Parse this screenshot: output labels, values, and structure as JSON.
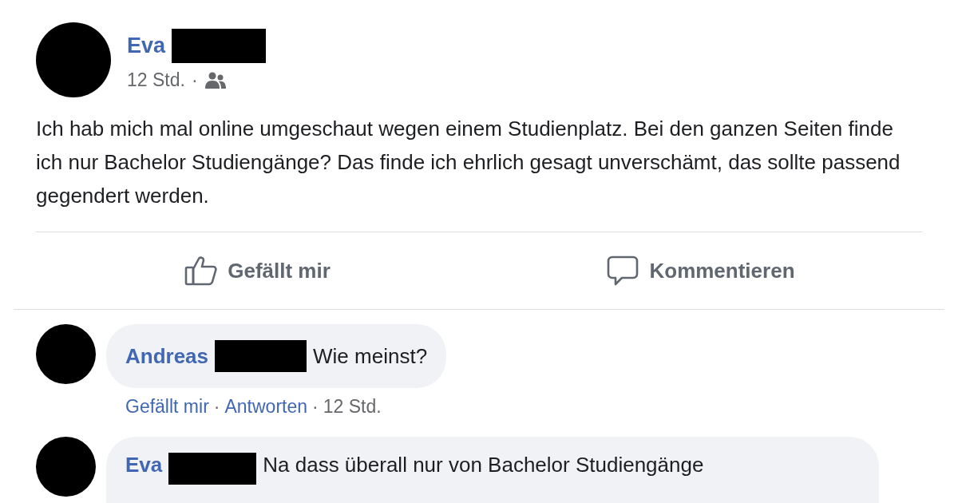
{
  "post": {
    "author": "Eva",
    "time": "12 Std.",
    "separator": "·",
    "text": "Ich hab mich mal online umgeschaut wegen einem Studienplatz. Bei den ganzen Seiten finde ich nur Bachelor Studiengänge? Das finde ich ehrlich gesagt unverschämt, das sollte passend gegendert werden."
  },
  "actions": [
    {
      "kind": "like",
      "label": "Gefällt mir"
    },
    {
      "kind": "comment",
      "label": "Kommentieren"
    }
  ],
  "comments": [
    {
      "author": "Andreas",
      "text": "Wie meinst?",
      "like": "Gefällt mir",
      "reply": "Antworten",
      "time": "12 Std.",
      "separator": "·"
    },
    {
      "author": "Eva",
      "text": "Na dass überall nur von Bachelor Studiengänge"
    }
  ]
}
